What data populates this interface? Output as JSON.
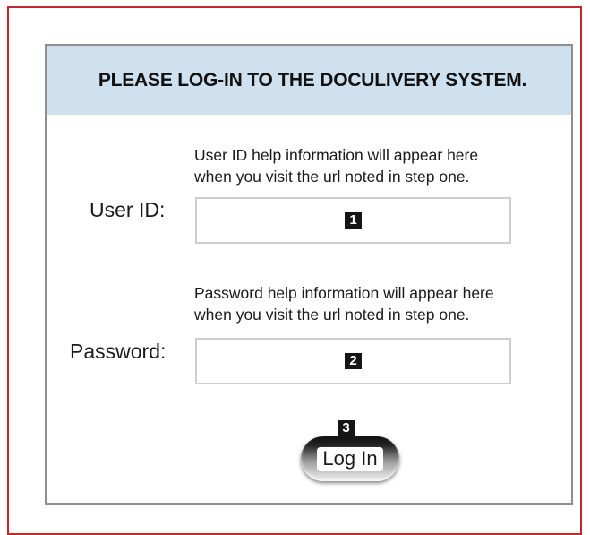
{
  "header": {
    "title": "PLEASE LOG-IN TO THE DOCULIVERY SYSTEM."
  },
  "user_id": {
    "help_line1": "User ID help information will appear here",
    "help_line2": "when you visit the url noted in step one.",
    "label": "User ID:",
    "step": "1"
  },
  "password": {
    "help_line1": "Password help information will appear here",
    "help_line2": "when you visit the url noted in step one.",
    "label": "Password:",
    "step": "2"
  },
  "login": {
    "step": "3",
    "label": "Log In"
  },
  "colors": {
    "frame_border": "#c8262c",
    "header_bg": "#cfe0ee",
    "panel_border": "#8e8e8e"
  }
}
